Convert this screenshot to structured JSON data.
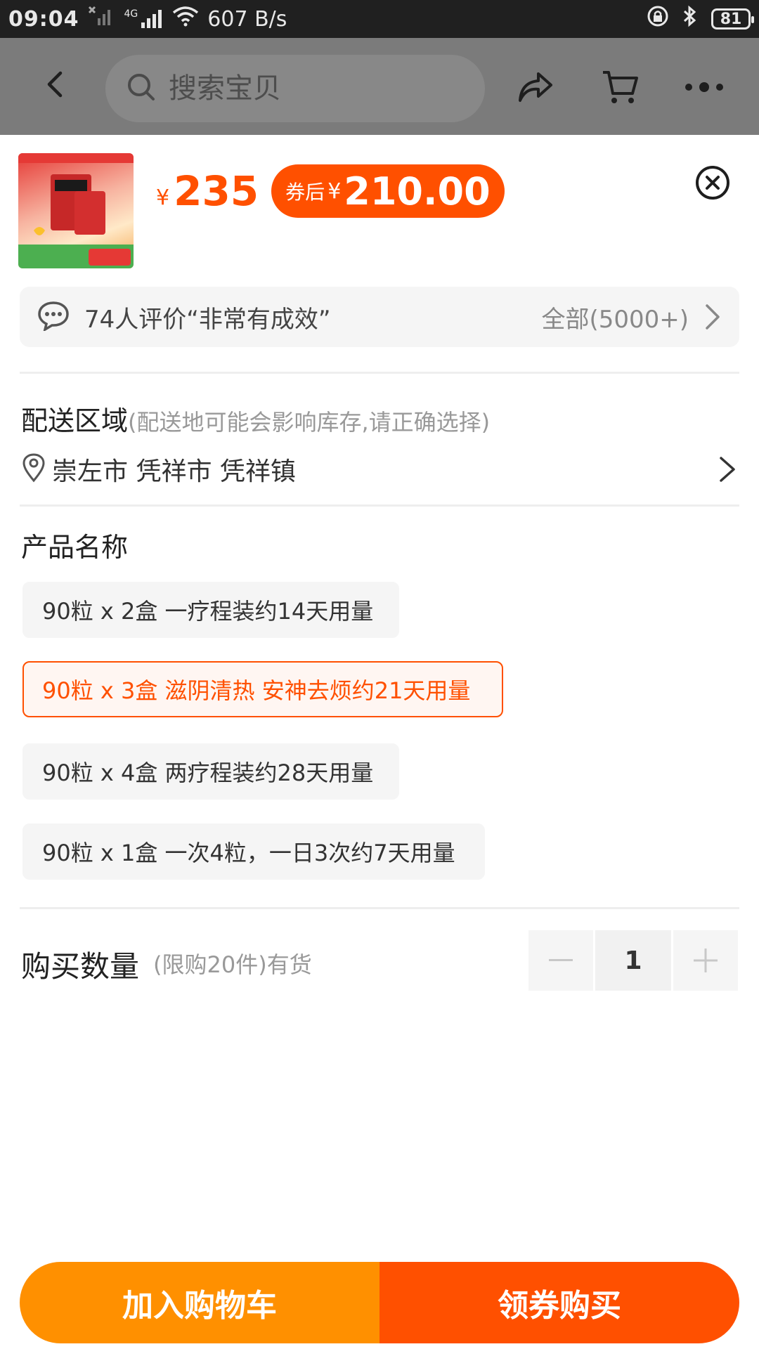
{
  "status_bar": {
    "time": "09:04",
    "network_type": "4G",
    "speed": "607 B/s",
    "battery": "81"
  },
  "top_bar": {
    "search_placeholder": "搜索宝贝"
  },
  "product": {
    "price_yen": "¥",
    "price": "235",
    "coupon_label": "券后",
    "coupon_yen": "¥",
    "coupon_price": "210.00"
  },
  "review": {
    "text": "74人评价“非常有成效”",
    "all_label": "全部(5000+)"
  },
  "delivery": {
    "title": "配送区域",
    "subtitle": "(配送地可能会影响库存,请正确选择)",
    "address": "崇左市 凭祥市 凭祥镇"
  },
  "product_options": {
    "title": "产品名称",
    "items": [
      {
        "label": "90粒 x 2盒 一疗程装约14天用量",
        "selected": false
      },
      {
        "label": "90粒 x 3盒 滋阴清热 安神去烦约21天用量",
        "selected": true
      },
      {
        "label": "90粒 x 4盒 两疗程装约28天用量",
        "selected": false
      },
      {
        "label": "90粒 x 1盒 一次4粒，一日3次约7天用量",
        "selected": false
      }
    ]
  },
  "quantity": {
    "title": "购买数量",
    "note": "(限购20件)有货",
    "value": "1"
  },
  "actions": {
    "add_to_cart": "加入购物车",
    "buy_with_coupon": "领券购买"
  },
  "colors": {
    "accent": "#ff5000",
    "cart": "#ff9000"
  }
}
